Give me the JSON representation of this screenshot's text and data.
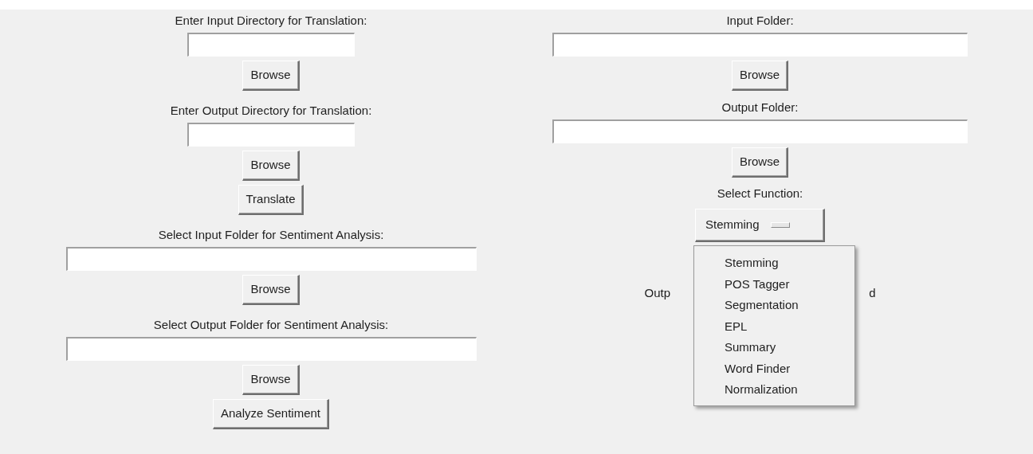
{
  "translation": {
    "input_label": "Enter Input Directory for Translation:",
    "input_browse": "Browse",
    "output_label": "Enter Output Directory for Translation:",
    "output_browse": "Browse",
    "action": "Translate"
  },
  "sentiment": {
    "input_label": "Select Input Folder for Sentiment Analysis:",
    "input_browse": "Browse",
    "output_label": "Select Output Folder for Sentiment Analysis:",
    "output_browse": "Browse",
    "action": "Analyze Sentiment"
  },
  "processing": {
    "input_label": "Input Folder:",
    "input_browse": "Browse",
    "output_label": "Output Folder:",
    "output_browse": "Browse",
    "function_label": "Select Function:",
    "function_menu": {
      "value": "Stemming",
      "expanded": true,
      "options": [
        "Stemming",
        "POS Tagger",
        "Segmentation",
        "EPL",
        "Summary",
        "Word Finder",
        "Normalization"
      ]
    },
    "hidden_label": {
      "left_part": "Outp",
      "right_part": "d"
    }
  }
}
